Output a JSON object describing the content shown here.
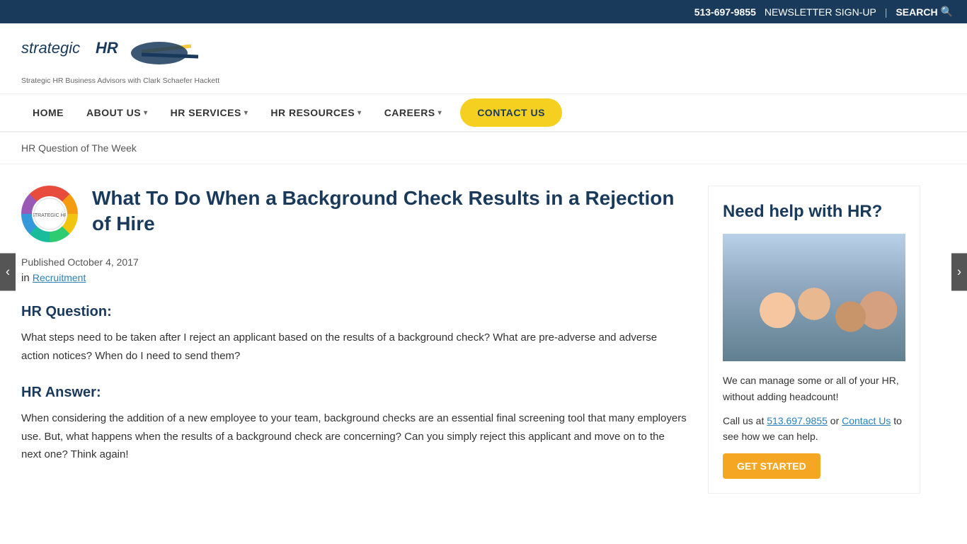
{
  "topbar": {
    "phone": "513-697-9855",
    "newsletter": "NEWSLETTER SIGN-UP",
    "divider": "|",
    "search": "SEARCH"
  },
  "header": {
    "logo_main": "strategic HR",
    "logo_tagline": "Strategic HR Business Advisors with Clark Schaefer Hackett"
  },
  "nav": {
    "items": [
      {
        "label": "HOME",
        "has_arrow": false
      },
      {
        "label": "ABOUT US",
        "has_arrow": true
      },
      {
        "label": "HR SERVICES",
        "has_arrow": true
      },
      {
        "label": "HR RESOURCES",
        "has_arrow": true
      },
      {
        "label": "CAREERS",
        "has_arrow": true
      }
    ],
    "contact_btn": "CONTACT US"
  },
  "breadcrumb": {
    "text": "HR Question of The Week"
  },
  "article": {
    "title": "What To Do When a Background Check Results in a Rejection of Hire",
    "published_label": "Published",
    "published_date": "October 4, 2017",
    "in_label": "in",
    "category": "Recruitment",
    "question_heading": "HR Question:",
    "question_text": "What steps need to be taken after I reject an applicant based on the results of a background check?  What are pre-adverse and adverse action notices?  When do I need to send them?",
    "answer_heading": "HR Answer:",
    "answer_text": "When considering the addition of a new employee to your team, background checks are an essential final screening tool that many employers use.  But, what happens when the results of a background check are concerning?  Can you simply reject this applicant and move on to the next one?  Think again!"
  },
  "sidebar": {
    "title": "Need help with HR?",
    "text1": "We can manage some or all of your HR, without adding headcount!",
    "text2_prefix": "Call us at ",
    "phone_link": "513.697.9855",
    "text2_mid": " or ",
    "contact_link": "Contact Us",
    "text2_suffix": " to see how we can help.",
    "cta_btn": "GET STARTED"
  }
}
